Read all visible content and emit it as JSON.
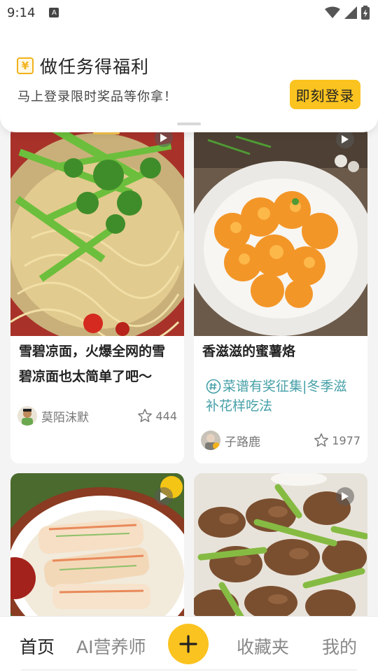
{
  "status_bar": {
    "time": "9:14",
    "notification_badge": "A"
  },
  "promo": {
    "icon": "yen-icon",
    "icon_glyph": "¥",
    "title": "做任务得福利",
    "subtitle": "马上登录限时奖品等你拿！",
    "login_button": "即刻登录"
  },
  "feed": [
    {
      "title": "雪碧凉面，火爆全网的雪碧凉面也太简单了吧～",
      "title_lines": [
        "雪碧凉面，火爆全网的雪",
        "碧凉面也太简单了吧～"
      ],
      "author": "莫陌沫默",
      "likes": "444",
      "has_video": true
    },
    {
      "title": "香滋滋的蜜薯烙",
      "tag": "#菜谱有奖征集|冬季滋补花样吃法",
      "tag_lines": [
        "菜谱有奖征集|冬季滋",
        "补花样吃法"
      ],
      "author": "子路鹿",
      "likes": "1977",
      "has_video": true
    },
    {
      "title": "",
      "author": "",
      "likes": "",
      "has_video": true
    },
    {
      "title": "",
      "author": "",
      "likes": "",
      "has_video": true
    }
  ],
  "bottom_nav": {
    "items": [
      {
        "label": "首页",
        "active": true
      },
      {
        "label": "AI营养师",
        "active": false
      },
      {
        "label": "收藏夹",
        "active": false
      },
      {
        "label": "我的",
        "active": false
      }
    ],
    "add_icon": "plus-icon"
  },
  "colors": {
    "accent": "#fbc320",
    "tag": "#46a0a8",
    "background": "#f4f4f4"
  }
}
